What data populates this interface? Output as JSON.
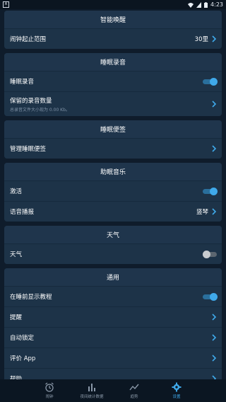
{
  "status_bar": {
    "time": "4:23",
    "left_icon": "A"
  },
  "sections": {
    "smart_wake": {
      "title": "智能唤醒",
      "alarm_range": {
        "label": "闹钟起止范围",
        "value": "30里"
      }
    },
    "sleep_recording": {
      "title": "睡眠录音",
      "record": {
        "label": "睡眠录音",
        "on": true
      },
      "kept": {
        "label": "保留的录音数量",
        "sub": "总录音文件大小现为 0.00 Kb。"
      }
    },
    "sleep_notes": {
      "title": "睡眠便签",
      "manage": {
        "label": "管理睡眠便签"
      }
    },
    "sleep_music": {
      "title": "助眠音乐",
      "activate": {
        "label": "激活",
        "on": true
      },
      "voice": {
        "label": "语音播报",
        "value": "竖琴"
      }
    },
    "weather": {
      "title": "天气",
      "weather": {
        "label": "天气",
        "on": false
      }
    },
    "general": {
      "title": "通用",
      "tutorial": {
        "label": "在睡前显示教程",
        "on": true
      },
      "reminder": {
        "label": "提醒"
      },
      "autolock": {
        "label": "自动锁定"
      },
      "rate": {
        "label": "评价 App"
      },
      "help": {
        "label": "帮助"
      }
    }
  },
  "bottom_nav": [
    {
      "label": "闹钟",
      "icon": "alarm-clock-icon"
    },
    {
      "label": "夜间统计数据",
      "icon": "bar-chart-icon"
    },
    {
      "label": "趋势",
      "icon": "trend-line-icon"
    },
    {
      "label": "设置",
      "icon": "gear-icon",
      "active": true
    }
  ],
  "colors": {
    "background": "#0f1c2b",
    "card": "#1c3147",
    "accent": "#3fa9ea"
  }
}
